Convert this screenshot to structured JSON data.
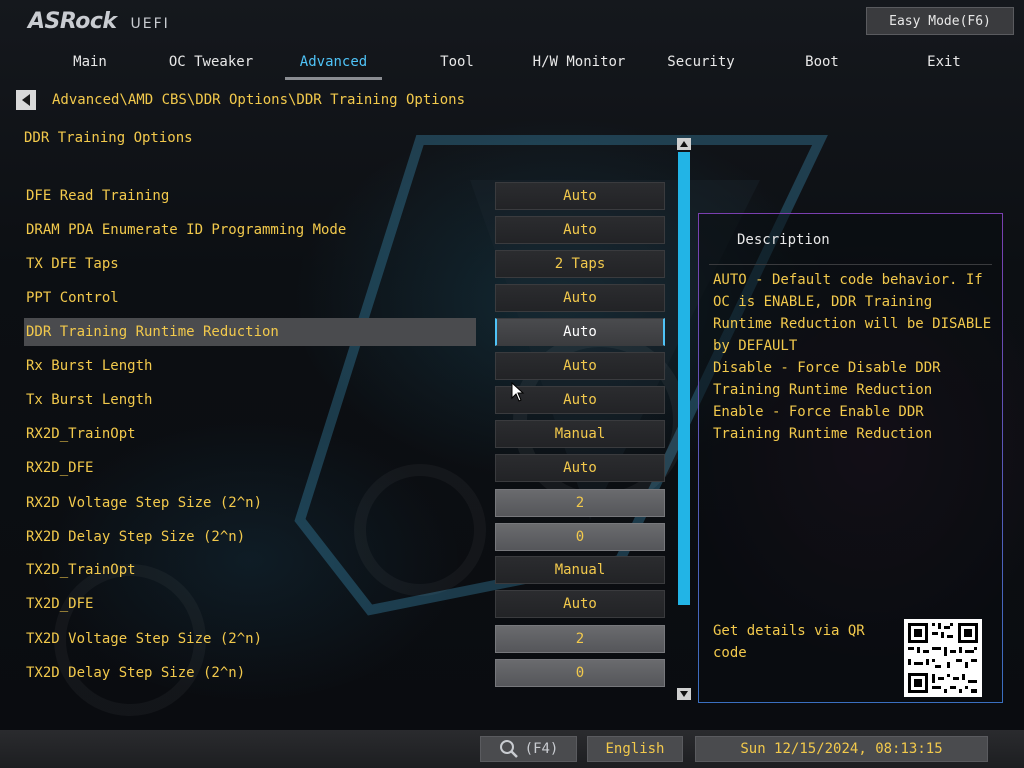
{
  "app": {
    "logo": "ASRock",
    "logo_sub": "UEFI"
  },
  "easy_mode_label": "Easy Mode(F6)",
  "nav": {
    "tabs": [
      {
        "label": "Main"
      },
      {
        "label": "OC Tweaker"
      },
      {
        "label": "Advanced",
        "active": true
      },
      {
        "label": "Tool"
      },
      {
        "label": "H/W Monitor"
      },
      {
        "label": "Security"
      },
      {
        "label": "Boot"
      },
      {
        "label": "Exit"
      }
    ]
  },
  "breadcrumb": "Advanced\\AMD CBS\\DDR Options\\DDR Training Options",
  "section_title": "DDR Training Options",
  "settings": [
    {
      "label": "DFE Read Training",
      "value": "Auto"
    },
    {
      "label": "DRAM PDA Enumerate ID Programming Mode",
      "value": "Auto"
    },
    {
      "label": "TX DFE Taps",
      "value": "2 Taps"
    },
    {
      "label": "PPT Control",
      "value": "Auto"
    },
    {
      "label": "DDR Training Runtime Reduction",
      "value": "Auto",
      "selected": true
    },
    {
      "label": "Rx Burst Length",
      "value": "Auto"
    },
    {
      "label": "Tx Burst Length",
      "value": "Auto"
    },
    {
      "label": "RX2D_TrainOpt",
      "value": "Manual"
    },
    {
      "label": "RX2D_DFE",
      "value": "Auto"
    },
    {
      "label": "RX2D Voltage Step Size (2^n)",
      "value": "2",
      "numeric": true
    },
    {
      "label": "RX2D Delay Step Size (2^n)",
      "value": "0",
      "numeric": true
    },
    {
      "label": "TX2D_TrainOpt",
      "value": "Manual"
    },
    {
      "label": "TX2D_DFE",
      "value": "Auto"
    },
    {
      "label": "TX2D Voltage Step Size (2^n)",
      "value": "2",
      "numeric": true
    },
    {
      "label": "TX2D Delay Step Size (2^n)",
      "value": "0",
      "numeric": true
    }
  ],
  "description": {
    "title": "Description",
    "lines": [
      "AUTO - Default code behavior. If",
      "OC is ENABLE, DDR Training",
      "Runtime Reduction will be DISABLE",
      "by DEFAULT",
      "Disable - Force Disable DDR",
      "Training Runtime Reduction",
      "Enable - Force Enable DDR",
      "Training Runtime Reduction"
    ],
    "qr_text": "Get details via QR code"
  },
  "status_bar": {
    "search_key": "(F4)",
    "language": "English",
    "datetime": "Sun 12/15/2024, 08:13:15"
  },
  "colors": {
    "accent": "#4fc3f7",
    "text": "#f2c94c",
    "scroll": "#22b4e6"
  },
  "icons": {
    "back": "arrow-left-icon",
    "search": "search-icon",
    "cursor": "mouse-cursor-icon",
    "qr": "qr-code-icon"
  }
}
